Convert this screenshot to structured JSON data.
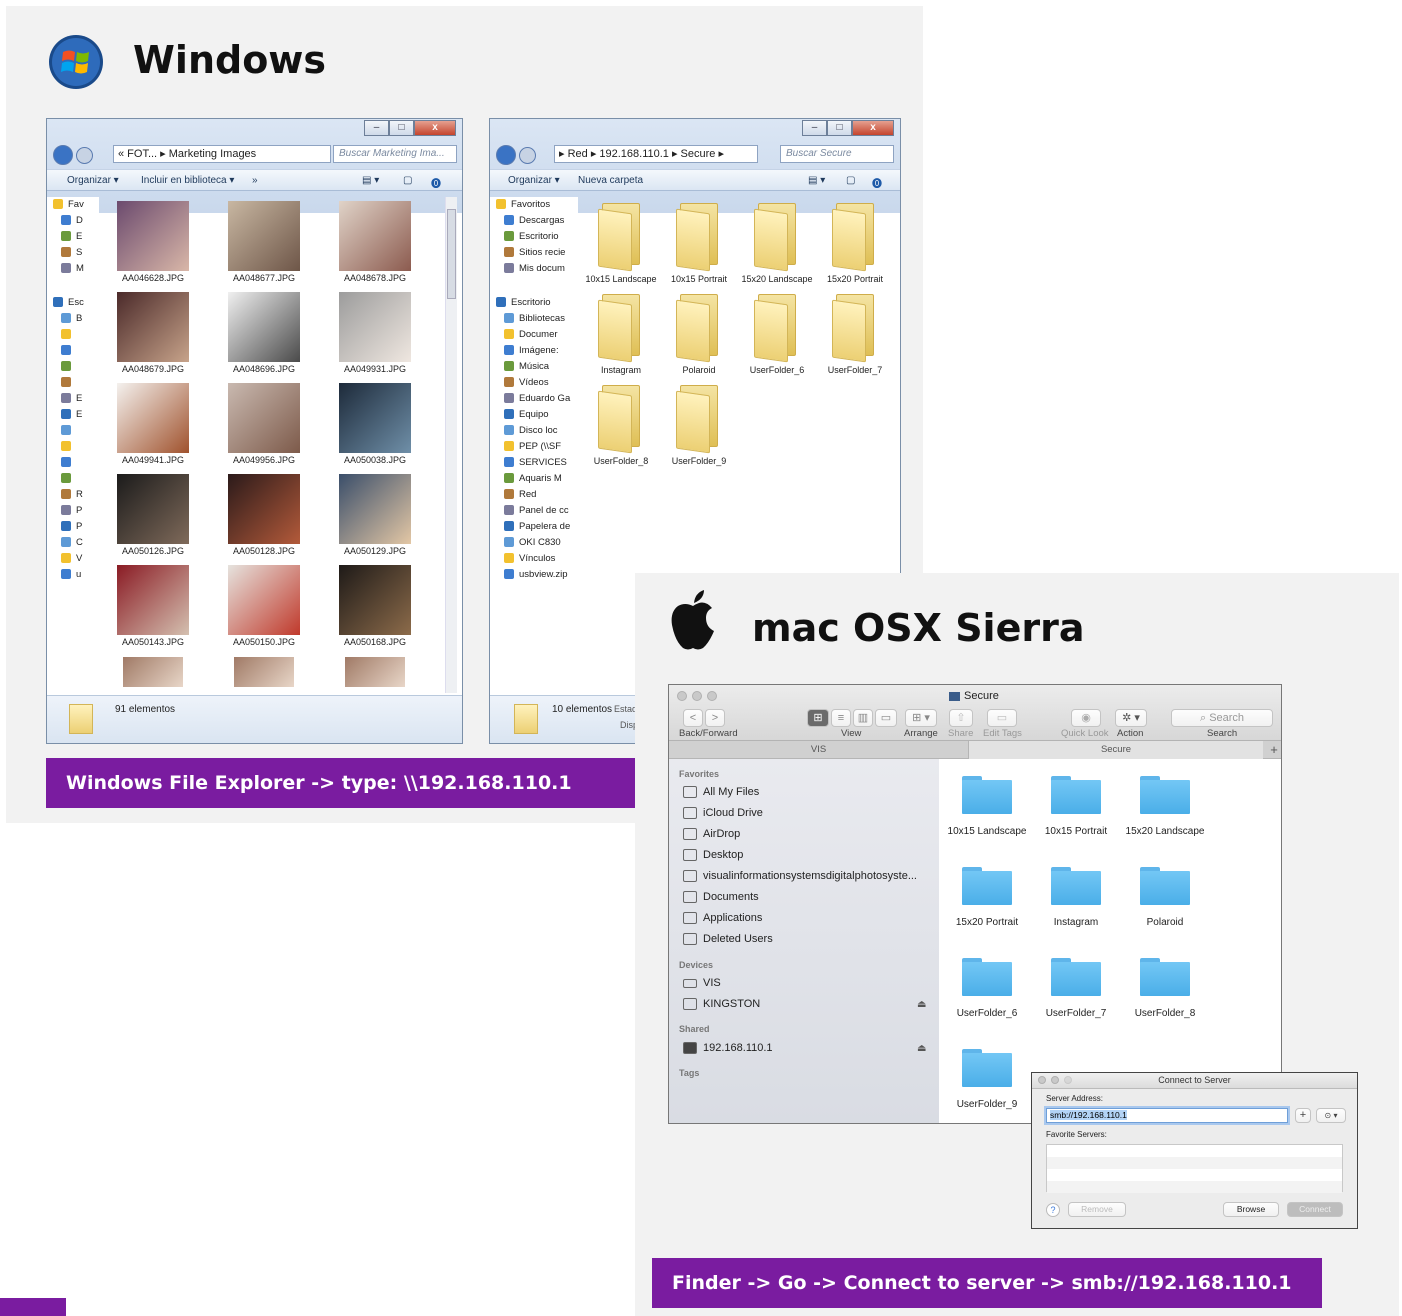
{
  "windows_section": {
    "title": "Windows",
    "caption": "Windows File Explorer -> type: \\\\192.168.110.1"
  },
  "mac_section": {
    "title": "mac OSX Sierra",
    "caption": "Finder -> Go -> Connect to server -> smb://192.168.110.1"
  },
  "explorer_left": {
    "breadcrumb": "« FOT... ▸ Marketing Images",
    "search_placeholder": "Buscar Marketing Ima...",
    "toolbar": {
      "organize": "Organizar ▾",
      "include": "Incluir en biblioteca ▾",
      "more": "»"
    },
    "tree": [
      "Fav",
      "D",
      "E",
      "S",
      "M",
      "Esc",
      "B",
      "",
      "",
      "",
      "",
      "E",
      "E",
      "",
      "",
      "",
      "",
      "R",
      "P",
      "P",
      "C",
      "V",
      "u"
    ],
    "files": [
      "AA046628.JPG",
      "AA048677.JPG",
      "AA048678.JPG",
      "AA048679.JPG",
      "AA048696.JPG",
      "AA049931.JPG",
      "AA049941.JPG",
      "AA049956.JPG",
      "AA050038.JPG",
      "AA050126.JPG",
      "AA050128.JPG",
      "AA050129.JPG",
      "AA050143.JPG",
      "AA050150.JPG",
      "AA050168.JPG"
    ],
    "status": "91 elementos"
  },
  "explorer_right": {
    "breadcrumb": "▸ Red ▸ 192.168.110.1 ▸ Secure ▸",
    "search_placeholder": "Buscar Secure",
    "toolbar": {
      "organize": "Organizar ▾",
      "new_folder": "Nueva carpeta"
    },
    "tree": [
      "Favoritos",
      "Descargas",
      "Escritorio",
      "Sitios recie",
      "Mis docum",
      "Escritorio",
      "Bibliotecas",
      "Documer",
      "Imágene:",
      "Música",
      "Vídeos",
      "Eduardo Ga",
      "Equipo",
      "Disco loc",
      "PEP (\\\\SF",
      "SERVICES",
      "Aquaris M",
      "Red",
      "Panel de cc",
      "Papelera de",
      "OKI C830",
      "Vínculos",
      "usbview.zip"
    ],
    "folders": [
      "10x15 Landscape",
      "10x15 Portrait",
      "15x20 Landscape",
      "15x20 Portrait",
      "Instagram",
      "Polaroid",
      "UserFolder_6",
      "UserFolder_7",
      "UserFolder_8",
      "UserFolder_9"
    ],
    "status": "10 elementos",
    "status_extra1": "Estad",
    "status_extra2": "Disp"
  },
  "finder": {
    "title": "Secure",
    "toolbar_labels": {
      "back_forward": "Back/Forward",
      "view": "View",
      "arrange": "Arrange",
      "share": "Share",
      "edit_tags": "Edit Tags",
      "quick_look": "Quick Look",
      "action": "Action",
      "search": "Search"
    },
    "search_placeholder": "Search",
    "tabs": [
      "VIS",
      "Secure"
    ],
    "sidebar": {
      "favorites_head": "Favorites",
      "favorites": [
        "All My Files",
        "iCloud Drive",
        "AirDrop",
        "Desktop",
        "visualinformationsystemsdigitalphotosyste...",
        "Documents",
        "Applications",
        "Deleted Users"
      ],
      "devices_head": "Devices",
      "devices": [
        "VIS",
        "KINGSTON"
      ],
      "shared_head": "Shared",
      "shared": [
        "192.168.110.1"
      ],
      "tags_head": "Tags"
    },
    "folders": [
      "10x15 Landscape",
      "10x15 Portrait",
      "15x20 Landscape",
      "15x20 Portrait",
      "Instagram",
      "Polaroid",
      "UserFolder_6",
      "UserFolder_7",
      "UserFolder_8",
      "UserFolder_9"
    ]
  },
  "connect_dialog": {
    "title": "Connect to Server",
    "server_address_label": "Server Address:",
    "server_address_value": "smb://192.168.110.1",
    "favorites_label": "Favorite Servers:",
    "help": "?",
    "remove": "Remove",
    "browse": "Browse",
    "connect": "Connect",
    "add": "+",
    "options": "⊙ ▾"
  },
  "colors": {
    "caption_purple": "#7a1ca0",
    "finder_folder_blue": "#5fb5ea",
    "win_folder_yellow": "#ecd074"
  }
}
